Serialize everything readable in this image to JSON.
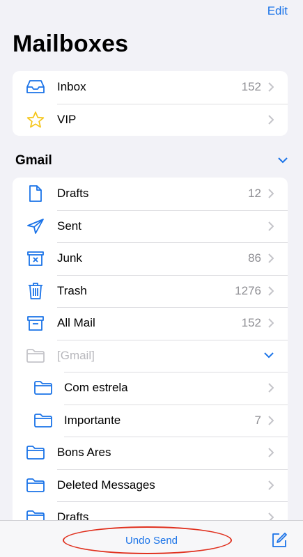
{
  "header": {
    "edit_label": "Edit",
    "title": "Mailboxes"
  },
  "top_group": [
    {
      "label": "Inbox",
      "count": "152",
      "icon": "inbox-tray-icon"
    },
    {
      "label": "VIP",
      "count": "",
      "icon": "star-icon"
    }
  ],
  "gmail": {
    "title": "Gmail",
    "items": [
      {
        "label": "Drafts",
        "count": "12",
        "icon": "document-icon"
      },
      {
        "label": "Sent",
        "count": "",
        "icon": "paper-plane-icon"
      },
      {
        "label": "Junk",
        "count": "86",
        "icon": "junk-box-icon"
      },
      {
        "label": "Trash",
        "count": "1276",
        "icon": "trash-icon"
      },
      {
        "label": "All Mail",
        "count": "152",
        "icon": "archive-box-icon"
      },
      {
        "label": "[Gmail]",
        "count": "",
        "icon": "folder-icon"
      },
      {
        "label": "Com estrela",
        "count": "",
        "icon": "folder-icon"
      },
      {
        "label": "Importante",
        "count": "7",
        "icon": "folder-icon"
      },
      {
        "label": "Bons Ares",
        "count": "",
        "icon": "folder-icon"
      },
      {
        "label": "Deleted Messages",
        "count": "",
        "icon": "folder-icon"
      },
      {
        "label": "Drafts",
        "count": "",
        "icon": "folder-icon"
      }
    ]
  },
  "bottom_bar": {
    "undo_send_label": "Undo Send",
    "compose_icon": "compose-icon"
  },
  "colors": {
    "accent": "#1a73e8",
    "star": "#f5c518",
    "annotation": "#e0301e"
  }
}
